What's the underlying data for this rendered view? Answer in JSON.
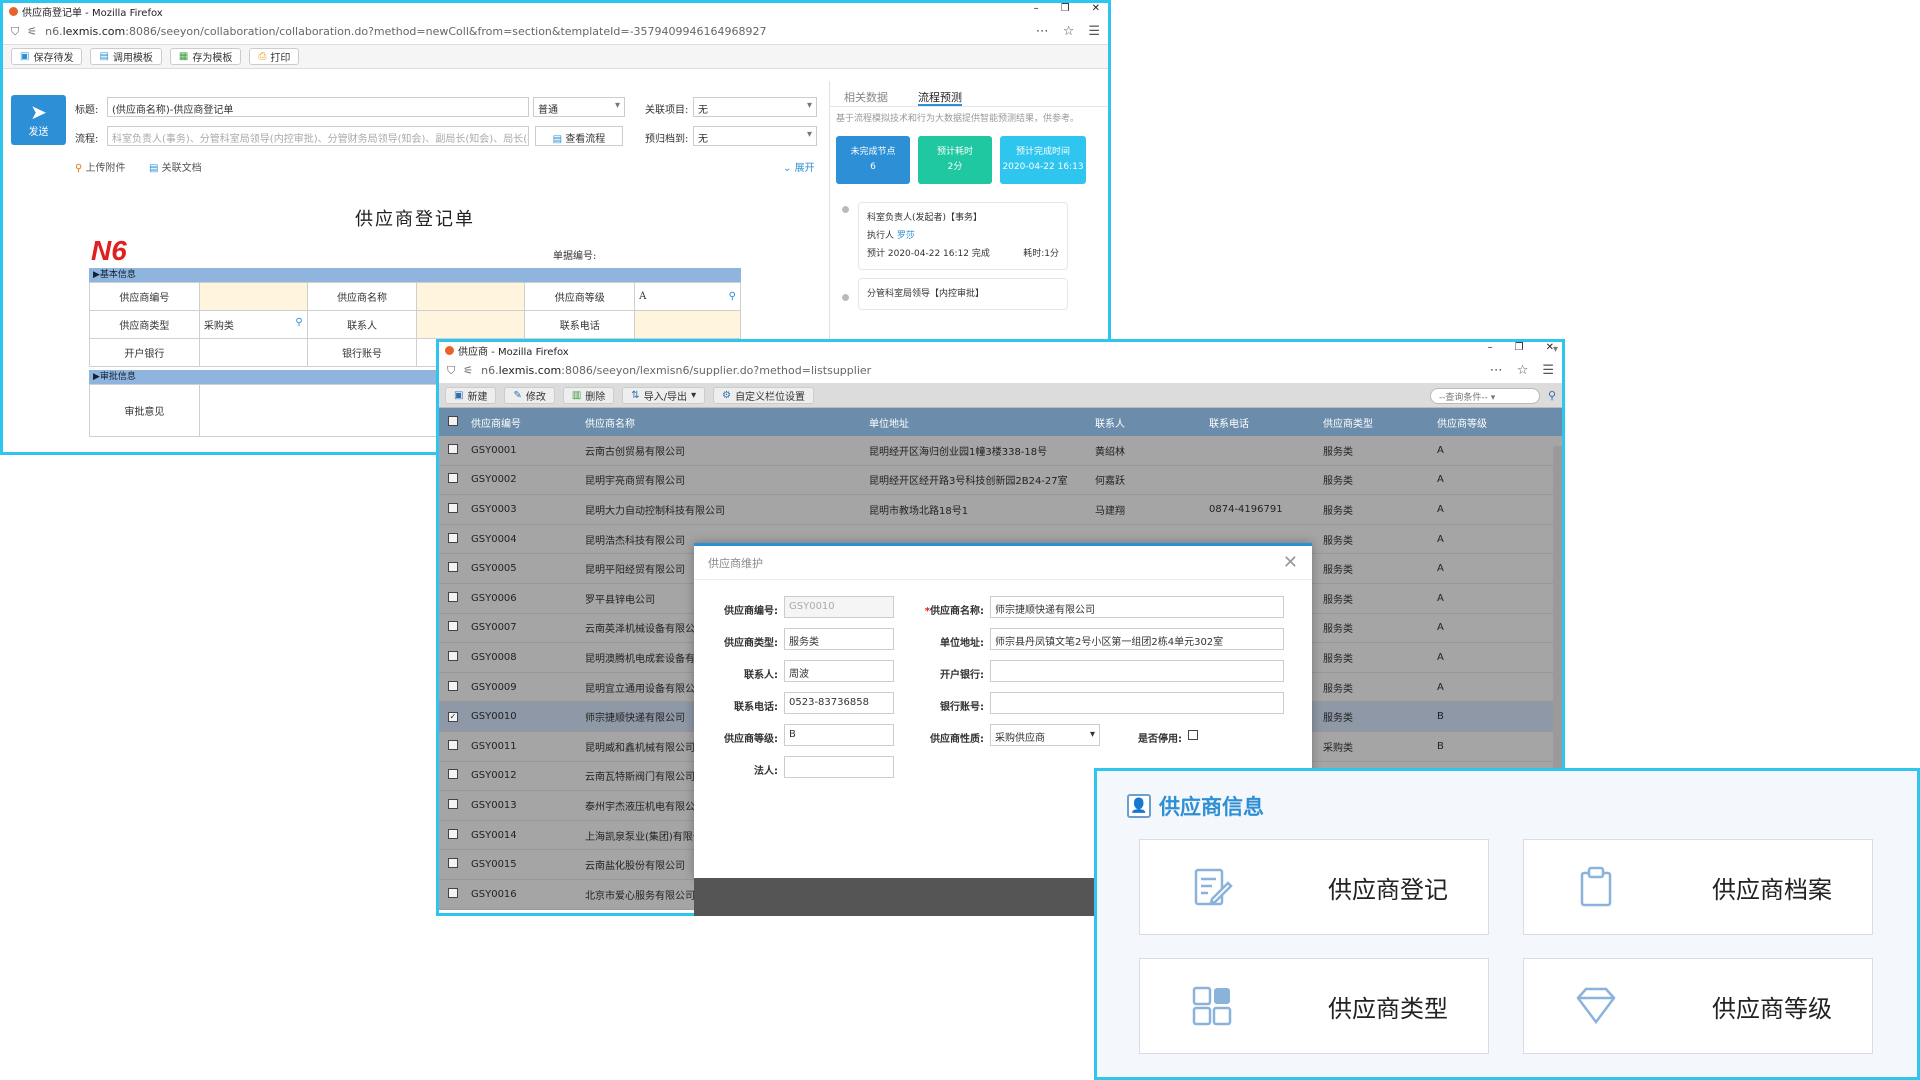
{
  "win1": {
    "title": "供应商登记单 - Mozilla Firefox",
    "url_pre": "n6.",
    "url_host": "lexmis.com",
    "url_post": ":8086/seeyon/collaboration/collaboration.do?method=newColl&from=section&templateId=-3579409946164968927",
    "toolbar": [
      "保存待发",
      "调用模板",
      "存为模板",
      "打印"
    ],
    "send": "发送",
    "labels": {
      "title": "标题:",
      "flow": "流程:",
      "related": "关联项目:",
      "archive": "预归档到:"
    },
    "title_value": "(供应商名称)-供应商登记单",
    "priority": "普通",
    "related_value": "无",
    "archive_value": "无",
    "flow_placeholder": "科室负责人(事务)、分管科室局领导(内控审批)、分管财务局领导(知会)、副局长(知会)、局长(事",
    "view_flow": "查看流程",
    "upload": "上传附件",
    "assoc_doc": "关联文档",
    "expand": "展开",
    "form_title": "供应商登记单",
    "logo": "N6",
    "doc_no": "单据编号:",
    "sec_basic": "▶基本信息",
    "sec_audit": "▶审批信息",
    "grid": {
      "r1": [
        "供应商编号",
        "",
        "供应商名称",
        "",
        "供应商等级",
        "A"
      ],
      "r2": [
        "供应商类型",
        "采购类",
        "联系人",
        "",
        "联系电话",
        ""
      ],
      "r3": [
        "开户银行",
        "",
        "银行账号",
        ""
      ]
    },
    "audit_label": "审批意见",
    "side": {
      "tabs": [
        "相关数据",
        "流程预测"
      ],
      "desc": "基于流程模拟技术和行为大数据提供智能预测结果，供参考。",
      "cards": [
        {
          "label": "未完成节点",
          "value": "6",
          "color": "#2d8fd5"
        },
        {
          "label": "预计耗时",
          "value": "2分",
          "color": "#1fc8a0"
        },
        {
          "label": "预计完成时间",
          "value": "2020-04-22 16:13",
          "color": "#2ec5ee"
        }
      ],
      "node1": {
        "name": "科室负责人(发起者)【事务】",
        "exec_label": "执行人",
        "exec": "罗莎",
        "time": "预计 2020-04-22 16:12 完成",
        "cost": "耗时:1分"
      },
      "node2": {
        "name": "分管科室局领导【内控审批】"
      }
    }
  },
  "win2": {
    "title": "供应商 - Mozilla Firefox",
    "url_pre": "n6.",
    "url_host": "lexmis.com",
    "url_post": ":8086/seeyon/lexmisn6/supplier.do?method=listsupplier",
    "toolbar": [
      "新建",
      "修改",
      "删除",
      "导入/导出",
      "自定义栏位设置"
    ],
    "query": "--查询条件--",
    "columns": [
      "供应商编号",
      "供应商名称",
      "单位地址",
      "联系人",
      "联系电话",
      "供应商类型",
      "供应商等级"
    ],
    "rows": [
      [
        "GSY0001",
        "云南古创贸易有限公司",
        "昆明经开区海归创业园1幢3楼338-18号",
        "黄绍林",
        "",
        "服务类",
        "A"
      ],
      [
        "GSY0002",
        "昆明宇亮商贸有限公司",
        "昆明经开区经开路3号科技创新园2B24-27室",
        "何嘉跃",
        "",
        "服务类",
        "A"
      ],
      [
        "GSY0003",
        "昆明大力自动控制科技有限公司",
        "昆明市教场北路18号1",
        "马建翔",
        "0874-4196791",
        "服务类",
        "A"
      ],
      [
        "GSY0004",
        "昆明浩杰科技有限公司",
        "",
        "",
        "",
        "服务类",
        "A"
      ],
      [
        "GSY0005",
        "昆明平阳经贸有限公司",
        "",
        "",
        "",
        "服务类",
        "A"
      ],
      [
        "GSY0006",
        "罗平县锌电公司",
        "",
        "",
        "",
        "服务类",
        "A"
      ],
      [
        "GSY0007",
        "云南英泽机械设备有限公司",
        "",
        "",
        "",
        "服务类",
        "A"
      ],
      [
        "GSY0008",
        "昆明澳腾机电成套设备有限公司",
        "",
        "",
        "",
        "服务类",
        "A"
      ],
      [
        "GSY0009",
        "昆明宜立通用设备有限公司",
        "",
        "",
        "",
        "服务类",
        "A"
      ],
      [
        "GSY0010",
        "师宗捷顺快递有限公司",
        "",
        "",
        "",
        "服务类",
        "B"
      ],
      [
        "GSY0011",
        "昆明威和鑫机械有限公司",
        "",
        "",
        "",
        "采购类",
        "B"
      ],
      [
        "GSY0012",
        "云南瓦特斯阀门有限公司",
        "",
        "",
        "",
        "",
        ""
      ],
      [
        "GSY0013",
        "泰州宇杰液压机电有限公司",
        "",
        "",
        "",
        "",
        ""
      ],
      [
        "GSY0014",
        "上海凯泉泵业(集团)有限公司",
        "",
        "",
        "",
        "",
        ""
      ],
      [
        "GSY0015",
        "云南盐化股份有限公司",
        "",
        "",
        "",
        "",
        ""
      ],
      [
        "GSY0016",
        "北京市爱心服务有限公司",
        "",
        "",
        "",
        "",
        ""
      ]
    ],
    "selected_row": 9
  },
  "modal": {
    "title": "供应商维护",
    "fields": {
      "code_label": "供应商编号:",
      "code": "GSY0010",
      "name_label": "*供应商名称:",
      "name": "师宗捷顺快递有限公司",
      "type_label": "供应商类型:",
      "type": "服务类",
      "addr_label": "单位地址:",
      "addr": "师宗县丹凤镇文笔2号小区第一组团2栋4单元302室",
      "contact_label": "联系人:",
      "contact": "周波",
      "bank_label": "开户银行:",
      "bank": "",
      "phone_label": "联系电话:",
      "phone": "0523-83736858",
      "account_label": "银行账号:",
      "account": "",
      "grade_label": "供应商等级:",
      "grade": "B",
      "nature_label": "供应商性质:",
      "nature": "采购供应商",
      "disabled_label": "是否停用:",
      "legal_label": "法人:",
      "legal": ""
    }
  },
  "panel": {
    "title": "供应商信息",
    "tiles": [
      {
        "label": "供应商登记",
        "icon": "edit-doc-icon"
      },
      {
        "label": "供应商档案",
        "icon": "clipboard-icon"
      },
      {
        "label": "供应商类型",
        "icon": "grid-blocks-icon"
      },
      {
        "label": "供应商等级",
        "icon": "diamond-icon"
      }
    ]
  }
}
